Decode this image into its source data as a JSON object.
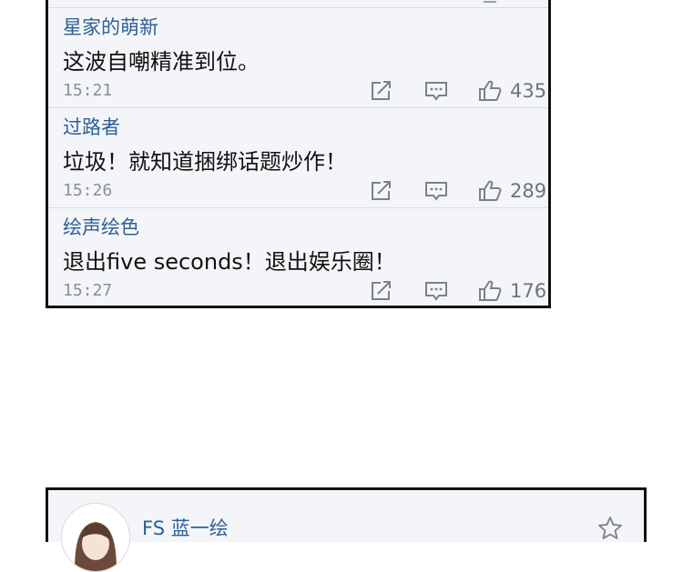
{
  "comments": [
    {
      "user": "星家的萌新",
      "text": "这波自嘲精准到位。",
      "time": "15:21",
      "likes": "435"
    },
    {
      "user": "过路者",
      "text": "垃圾！就知道捆绑话题炒作！",
      "time": "15:26",
      "likes": "289"
    },
    {
      "user": "绘声绘色",
      "text": "退出five seconds！退出娱乐圈！",
      "time": "15:27",
      "likes": "176"
    }
  ],
  "next_post": {
    "user": "FS 蓝一绘"
  },
  "icons": {
    "share": "share-icon",
    "reply": "comment-icon",
    "like": "thumbs-up-icon",
    "favorite": "star-icon"
  },
  "colors": {
    "username": "#2f5f94",
    "panel_bg": "#f3f5f8",
    "meta": "#8a8f96",
    "border": "#111111"
  }
}
